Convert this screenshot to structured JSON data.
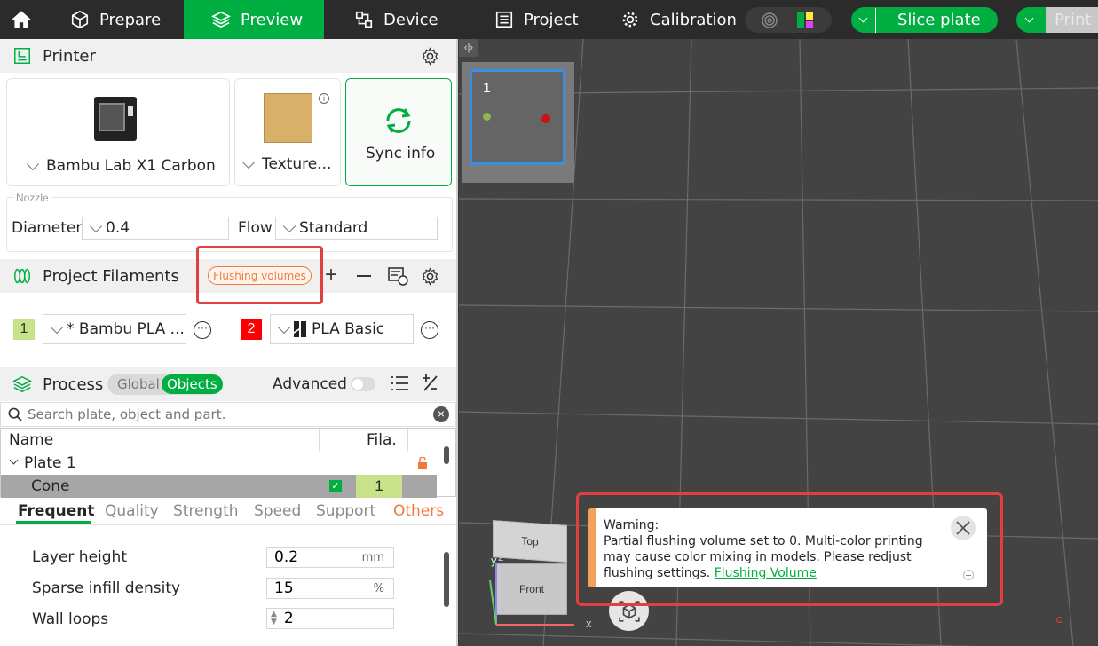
{
  "topbar": {
    "home_icon": "home-icon",
    "prepare": "Prepare",
    "preview": "Preview",
    "device": "Device",
    "project": "Project",
    "calibration": "Calibration",
    "slice_plate": "Slice plate",
    "print": "Print"
  },
  "printer": {
    "section_title": "Printer",
    "printer_name": "Bambu Lab X1 Carbon",
    "plate_name": "Texture...",
    "sync_label": "Sync info",
    "nozzle_group": "Nozzle",
    "diameter_label": "Diameter",
    "diameter_value": "0.4",
    "flow_label": "Flow",
    "flow_value": "Standard"
  },
  "filaments": {
    "section_title": "Project Filaments",
    "flushing_button": "Flushing volumes",
    "items": [
      {
        "index": "1",
        "name": "* Bambu PLA ...",
        "color": "#c7e28a"
      },
      {
        "index": "2",
        "name": "PLA Basic",
        "color": "#ff0000"
      }
    ]
  },
  "process": {
    "section_title": "Process",
    "global_label": "Global",
    "objects_label": "Objects",
    "advanced_label": "Advanced",
    "search_placeholder": "Search plate, object and part.",
    "col_name": "Name",
    "col_fila": "Fila.",
    "plate_row": "Plate 1",
    "object_row": "Cone",
    "object_fila": "1",
    "tabs": [
      "Frequent",
      "Quality",
      "Strength",
      "Speed",
      "Support",
      "Others"
    ],
    "params": [
      {
        "label": "Layer height",
        "value": "0.2",
        "unit": "mm"
      },
      {
        "label": "Sparse infill density",
        "value": "15",
        "unit": "%"
      },
      {
        "label": "Wall loops",
        "value": "2",
        "unit": ""
      }
    ]
  },
  "viewport": {
    "plate_number": "1",
    "cube_top": "Top",
    "cube_front": "Front",
    "axis_x": "x",
    "axis_y": "y",
    "axis_z": "z",
    "collapse_glyph": "‹|›"
  },
  "warning": {
    "title": "Warning:",
    "body": "Partial flushing volume set to 0. Multi-color printing may cause color mixing in models. Please redjust flushing settings.",
    "link": "Flushing Volume"
  },
  "colors": {
    "accent": "#00ae42",
    "warning_bar": "#f4a259",
    "highlight_box": "#e04040",
    "others_tab": "#f07a3a"
  }
}
